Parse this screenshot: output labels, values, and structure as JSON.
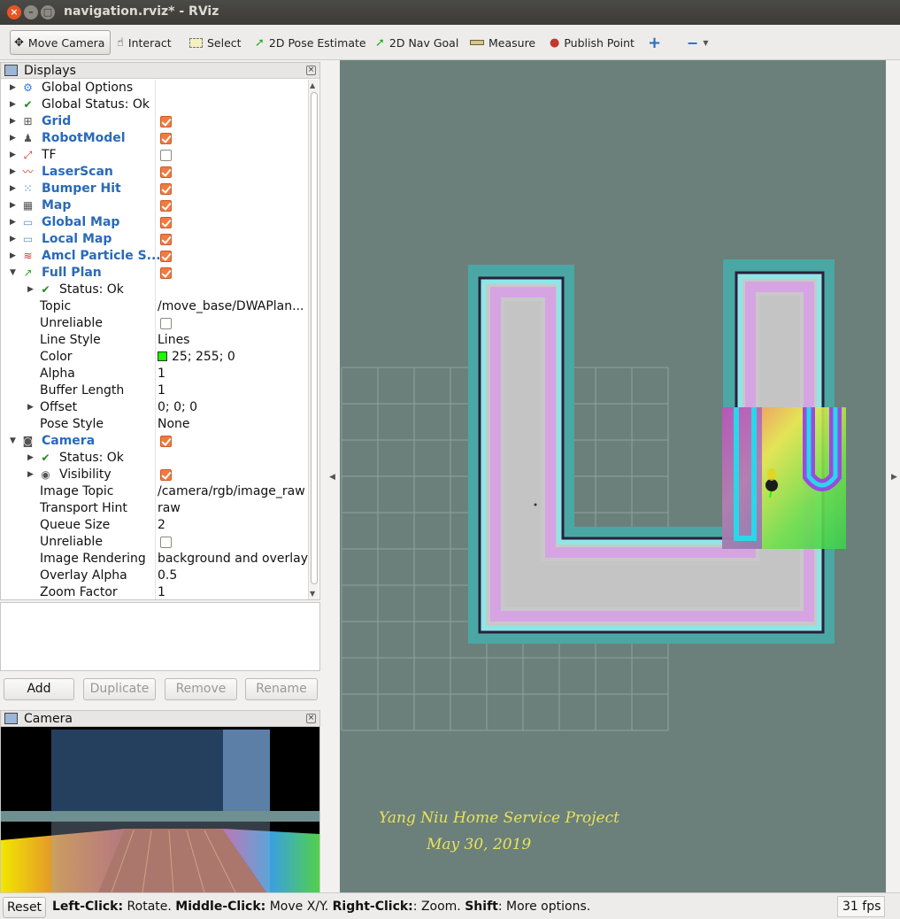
{
  "window": {
    "title": "navigation.rviz* - RViz"
  },
  "toolbar": {
    "move_camera": "Move Camera",
    "interact": "Interact",
    "select": "Select",
    "pose_estimate": "2D Pose Estimate",
    "nav_goal": "2D Nav Goal",
    "measure": "Measure",
    "publish_point": "Publish Point"
  },
  "displays_panel": {
    "title": "Displays",
    "rows": [
      {
        "label": "Global Options",
        "value": ""
      },
      {
        "label": "Global Status: Ok",
        "value": ""
      },
      {
        "label": "Grid",
        "checked": true
      },
      {
        "label": "RobotModel",
        "checked": true
      },
      {
        "label": "TF",
        "checked": false
      },
      {
        "label": "LaserScan",
        "checked": true
      },
      {
        "label": "Bumper Hit",
        "checked": true
      },
      {
        "label": "Map",
        "checked": true
      },
      {
        "label": "Global Map",
        "checked": true
      },
      {
        "label": "Local Map",
        "checked": true
      },
      {
        "label": "Amcl Particle S...",
        "checked": true
      },
      {
        "label": "Full Plan",
        "checked": true
      },
      {
        "label": "Status: Ok",
        "value": ""
      },
      {
        "label": "Topic",
        "value": "/move_base/DWAPlan..."
      },
      {
        "label": "Unreliable",
        "checked": false
      },
      {
        "label": "Line Style",
        "value": "Lines"
      },
      {
        "label": "Color",
        "value": "25; 255; 0",
        "swatch": "#19ff00"
      },
      {
        "label": "Alpha",
        "value": "1"
      },
      {
        "label": "Buffer Length",
        "value": "1"
      },
      {
        "label": "Offset",
        "value": "0; 0; 0"
      },
      {
        "label": "Pose Style",
        "value": "None"
      },
      {
        "label": "Camera",
        "checked": true
      },
      {
        "label": "Status: Ok",
        "value": ""
      },
      {
        "label": "Visibility",
        "checked": true
      },
      {
        "label": "Image Topic",
        "value": "/camera/rgb/image_raw"
      },
      {
        "label": "Transport Hint",
        "value": "raw"
      },
      {
        "label": "Queue Size",
        "value": "2"
      },
      {
        "label": "Unreliable",
        "checked": false
      },
      {
        "label": "Image Rendering",
        "value": "background and overlay"
      },
      {
        "label": "Overlay Alpha",
        "value": "0.5"
      },
      {
        "label": "Zoom Factor",
        "value": "1"
      }
    ]
  },
  "buttons": {
    "add": "Add",
    "duplicate": "Duplicate",
    "remove": "Remove",
    "rename": "Rename"
  },
  "camera_panel": {
    "title": "Camera"
  },
  "view": {
    "annotation_line1": "Yang Niu Home Service Project",
    "annotation_line2": "May 30, 2019",
    "plan_color": "#19ff00"
  },
  "statusbar": {
    "reset": "Reset",
    "left_click": "Left-Click:",
    "left_click_action": " Rotate. ",
    "middle_click": "Middle-Click:",
    "middle_click_action": " Move X/Y. ",
    "right_click": "Right-Click:",
    "right_click_action": ": Zoom. ",
    "shift": "Shift",
    "shift_action": ": More options.",
    "fps": "31 fps"
  }
}
